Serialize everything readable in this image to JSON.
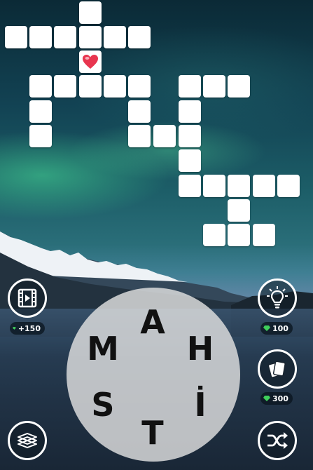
{
  "game": {
    "letters": [
      "A",
      "H",
      "İ",
      "T",
      "S",
      "M"
    ]
  },
  "buttons": {
    "video": {
      "icon": "film-play-icon",
      "reward": "+150"
    },
    "hint": {
      "icon": "lightbulb-icon",
      "cost": "100"
    },
    "cards": {
      "icon": "cards-icon",
      "cost": "300"
    },
    "dictionary": {
      "icon": "books-icon"
    },
    "shuffle": {
      "icon": "shuffle-icon"
    }
  },
  "colors": {
    "tile": "#ffffff",
    "gem": "#3fce5b",
    "heart": "#e8354f",
    "wheel": "#e1e1e1"
  }
}
